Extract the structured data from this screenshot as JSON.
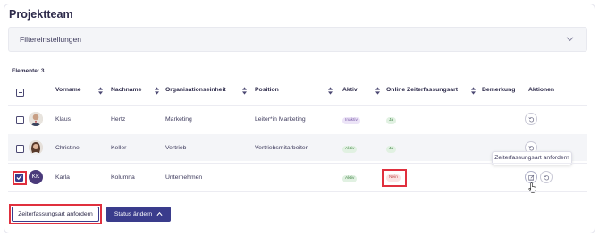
{
  "page": {
    "title": "Projektteam"
  },
  "filter": {
    "label": "Filtereinstellungen",
    "icon": "chevron-down-icon"
  },
  "table": {
    "count_label": "Elemente: 3",
    "headers": {
      "vorname": "Vorname",
      "nachname": "Nachname",
      "orgeinheit": "Organisationseinheit",
      "position": "Position",
      "aktiv": "Aktiv",
      "online": "Online Zeiterfassungsart",
      "bemerkung": "Bemerkung",
      "aktionen": "Aktionen"
    },
    "rows": [
      {
        "vorname": "Klaus",
        "nachname": "Hertz",
        "orgeinheit": "Marketing",
        "position": "Leiter*in Marketing",
        "aktiv": "Inaktiv",
        "online": "Ja",
        "checked": false,
        "avatar": "photo"
      },
      {
        "vorname": "Christine",
        "nachname": "Keller",
        "orgeinheit": "Vertrieb",
        "position": "Vertriebsmitarbeiter",
        "aktiv": "Aktiv",
        "online": "Ja",
        "checked": false,
        "avatar": "photo"
      },
      {
        "vorname": "Karla",
        "nachname": "Kolumna",
        "orgeinheit": "Unternehmen",
        "position": "",
        "aktiv": "Aktiv",
        "online": "Nein",
        "checked": true,
        "avatar": "KK"
      }
    ]
  },
  "tooltip": {
    "text": "Zeiterfassungsart anfordern"
  },
  "buttons": {
    "request": "Zeiterfassungsart anfordern",
    "status": "Status ändern"
  },
  "colors": {
    "accent": "#3a3c8c",
    "highlight": "#e0303e"
  }
}
